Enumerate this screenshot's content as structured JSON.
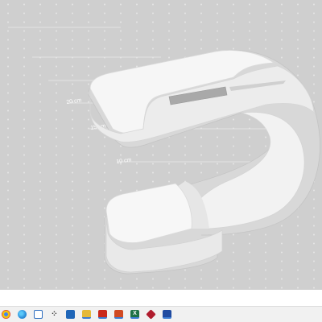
{
  "viewport": {
    "ruler_labels": [
      "20 cm",
      "15 cm",
      "10 cm"
    ]
  },
  "taskbar": {
    "icons": [
      {
        "name": "chrome-icon",
        "color": "#e0a21a",
        "glyph": ""
      },
      {
        "name": "edge-icon",
        "color": "#2b8bd6",
        "glyph": ""
      },
      {
        "name": "file-explorer-icon",
        "color": "#2f6fc0",
        "glyph": ""
      },
      {
        "name": "grid-app-icon",
        "color": "#3a3a3a",
        "glyph": "⁘"
      },
      {
        "name": "settings-icon",
        "color": "#1f66b8",
        "glyph": ""
      },
      {
        "name": "folder-icon",
        "color": "#e5b93a",
        "glyph": ""
      },
      {
        "name": "acrobat-icon",
        "color": "#c9281c",
        "glyph": ""
      },
      {
        "name": "powerpoint-icon",
        "color": "#d04a23",
        "glyph": ""
      },
      {
        "name": "excel-icon",
        "color": "#1e7145",
        "glyph": "X"
      },
      {
        "name": "ruby-app-icon",
        "color": "#b01c2e",
        "glyph": ""
      },
      {
        "name": "analytics-app-icon",
        "color": "#1f4aa0",
        "glyph": ""
      }
    ]
  }
}
